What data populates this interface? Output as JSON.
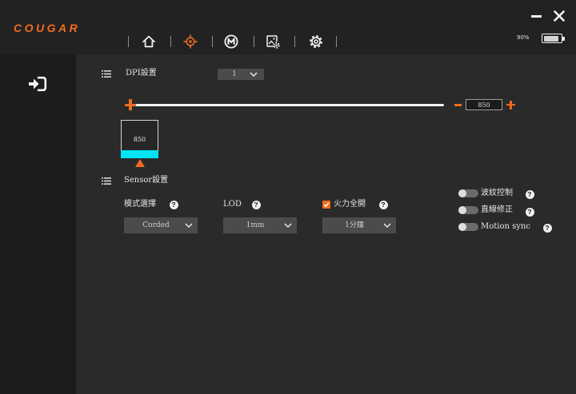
{
  "header": {
    "logo": "COUGAR",
    "nav": [
      {
        "icon": "home-icon",
        "active": false
      },
      {
        "icon": "target-icon",
        "active": true
      },
      {
        "icon": "m-circle-icon",
        "active": false
      },
      {
        "icon": "image-settings-icon",
        "active": false
      },
      {
        "icon": "gear-icon",
        "active": false
      }
    ],
    "window_controls": [
      {
        "icon": "minimize-icon"
      },
      {
        "icon": "close-icon"
      }
    ],
    "battery": {
      "label": "90%",
      "level": 0.9,
      "icon": "battery-icon"
    }
  },
  "sidebar": {
    "items": [
      {
        "icon": "sign-in-icon"
      }
    ]
  },
  "dpi": {
    "title": "DPI設置",
    "header_icon": "list-icon",
    "stage_select": {
      "value": "1",
      "icon": "chevron-down-icon"
    },
    "slider": {
      "position": 0
    },
    "stepper": {
      "value": "850",
      "minus_icon": "minus-icon",
      "plus_icon": "plus-icon"
    },
    "stages": [
      {
        "value": "850",
        "selected": true,
        "marker_icon": "triangle-up-icon"
      }
    ]
  },
  "sensor": {
    "title": "Sensor設置",
    "header_icon": "list-icon",
    "mode": {
      "label": "模式選擇",
      "value": "Corded"
    },
    "lod": {
      "label": "LOD",
      "value": "1mm"
    },
    "turbo": {
      "label": "火力全開",
      "checked": true,
      "value": "1分鐘"
    },
    "toggles": [
      {
        "label": "波紋控制",
        "on": false
      },
      {
        "label": "直線修正",
        "on": false
      },
      {
        "label": "Motion sync",
        "on": false
      }
    ]
  },
  "ui": {
    "help_glyph": "?",
    "help_icon": "help-icon"
  },
  "colors": {
    "accent": "#f26b1d",
    "stage_active": "#00e5f5",
    "toggle_off": "#6b6b6b"
  }
}
